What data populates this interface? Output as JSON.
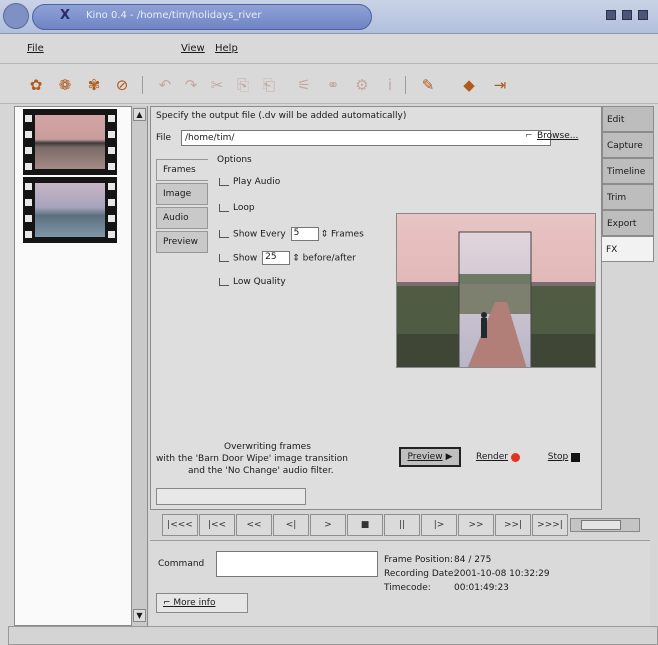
{
  "window": {
    "title": "Kino 0.4 - /home/tim/holidays_river",
    "logo": "X"
  },
  "menu": {
    "file": "File",
    "view": "View",
    "help": "Help"
  },
  "toolbar": {
    "icons": [
      "new-project-icon",
      "open-icon",
      "save-icon",
      "clear-icon",
      "undo-icon",
      "redo-icon",
      "cut-icon",
      "copy-icon",
      "paste-icon",
      "split-icon",
      "join-icon",
      "properties-icon",
      "info-icon",
      "publish-icon",
      "color-icon",
      "exit-icon"
    ]
  },
  "main": {
    "instruction": "Specify the output file (.dv will be added automatically)",
    "file_label": "File",
    "file_value": "/home/tim/",
    "browse_label": "Browse...",
    "subtabs": [
      "Frames",
      "Image",
      "Audio",
      "Preview"
    ],
    "options_title": "Options",
    "play_audio": "Play Audio",
    "loop": "Loop",
    "show_every_prefix": "Show Every",
    "show_every_value": "5",
    "show_every_suffix": "Frames",
    "show_prefix": "Show",
    "show_value": "25",
    "show_suffix": "before/after",
    "low_quality": "Low Quality",
    "status_line1": "Overwriting frames",
    "status_line2": "with the 'Barn Door Wipe' image transition",
    "status_line3": "and the 'No Change' audio filter.",
    "preview_label": "Preview",
    "render_label": "Render",
    "stop_label": "Stop"
  },
  "right_tabs": [
    "Edit",
    "Capture",
    "Timeline",
    "Trim",
    "Export",
    "FX"
  ],
  "transport": {
    "buttons": [
      "|<<<",
      "|<<",
      "<<",
      "<|",
      ">",
      "■",
      "||",
      "|>",
      ">>",
      ">>|",
      ">>>|"
    ]
  },
  "bottom": {
    "command_label": "Command",
    "frame_position_label": "Frame Position:",
    "frame_position_value": "84 / 275",
    "recording_date_label": "Recording Date:",
    "recording_date_value": "2001-10-08 10:32:29",
    "timecode_label": "Timecode:",
    "timecode_value": "00:01:49:23",
    "more_info": "More info"
  },
  "colors": {
    "accent_title": "#7f90c4",
    "render_dot": "#e0341f",
    "stop_square": "#111111"
  }
}
